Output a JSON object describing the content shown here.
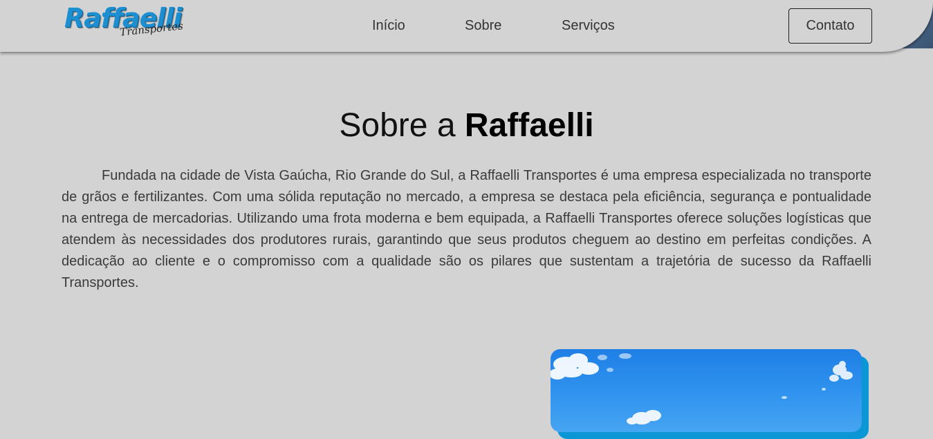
{
  "header": {
    "logo": {
      "main": "Raffaelli",
      "sub": "Transportes"
    },
    "nav": [
      {
        "label": "Início"
      },
      {
        "label": "Sobre"
      },
      {
        "label": "Serviços"
      }
    ],
    "contact_label": "Contato"
  },
  "about": {
    "title_prefix": "Sobre a",
    "title_bold": "Raffaelli",
    "text": "Fundada na cidade de Vista Gaúcha, Rio Grande do Sul, a Raffaelli Transportes é uma empresa especializada no transporte de grãos e fertilizantes. Com uma sólida reputação no mercado, a empresa se destaca pela eficiência, segurança e pontualidade na entrega de mercadorias. Utilizando uma frota moderna e bem equipada, a Raffaelli Transportes oferece soluções logísticas que atendem às necessidades dos produtores rurais, garantindo que seus produtos cheguem ao destino em perfeitas condições. A dedicação ao cliente e o compromisso com a qualidade são os pilares que sustentam a trajetória de sucesso da Raffaelli Transportes."
  },
  "colors": {
    "page_background": "#d3d3d3",
    "logo_blue": "#1d8fd0",
    "card_accent": "#0b97d6",
    "sky_blue": "#2f92ee"
  }
}
